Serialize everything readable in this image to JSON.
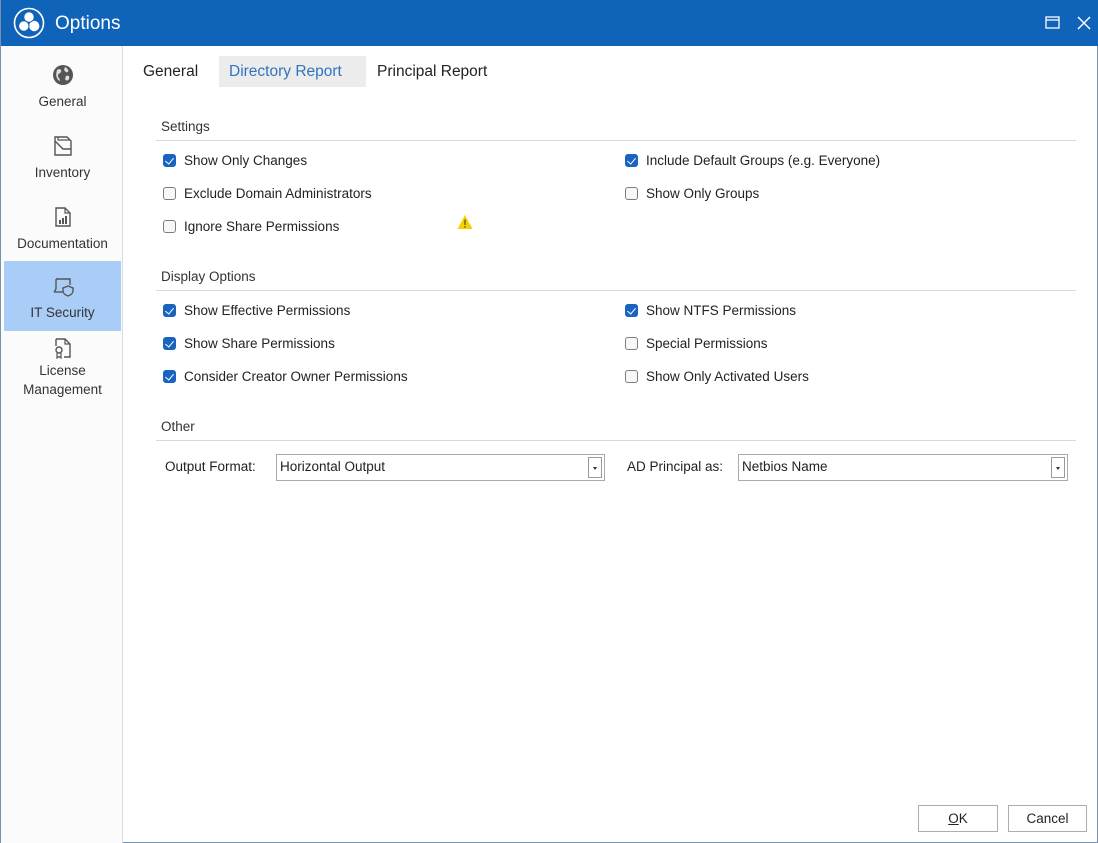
{
  "window": {
    "title": "Options",
    "app_icon": "hexagon-cluster-logo-icon",
    "controls": [
      {
        "name": "maximize",
        "icon": "maximize-icon"
      },
      {
        "name": "close",
        "icon": "close-icon"
      }
    ]
  },
  "sidebar": {
    "items": [
      {
        "label": "General",
        "icon": "globe-icon",
        "active": false
      },
      {
        "label": "Inventory",
        "icon": "folder-stack-icon",
        "active": false
      },
      {
        "label": "Documentation",
        "icon": "report-chart-icon",
        "active": false
      },
      {
        "label": "IT Security",
        "icon": "laptop-shield-icon",
        "active": true
      },
      {
        "label_line1": "License",
        "label_line2": "Management",
        "icon": "certificate-icon",
        "active": false
      }
    ]
  },
  "tabs": [
    {
      "label": "General",
      "active": false
    },
    {
      "label": "Directory Report",
      "active": true
    },
    {
      "label": "Principal Report",
      "active": false
    }
  ],
  "sections": {
    "settings": {
      "title": "Settings",
      "left": [
        {
          "label": "Show Only Changes",
          "checked": true
        },
        {
          "label": "Exclude Domain Administrators",
          "checked": false
        },
        {
          "label": "Ignore Share Permissions",
          "checked": false,
          "icon": "warning-icon"
        }
      ],
      "right": [
        {
          "label": "Include Default Groups (e.g. Everyone)",
          "checked": true
        },
        {
          "label": "Show Only Groups",
          "checked": false
        }
      ]
    },
    "display": {
      "title": "Display Options",
      "left": [
        {
          "label": "Show Effective Permissions",
          "checked": true
        },
        {
          "label": "Show Share Permissions",
          "checked": true
        },
        {
          "label": "Consider Creator Owner Permissions",
          "checked": true
        }
      ],
      "right": [
        {
          "label": "Show NTFS Permissions",
          "checked": true
        },
        {
          "label": "Special Permissions",
          "checked": false
        },
        {
          "label": "Show Only Activated Users",
          "checked": false
        }
      ]
    },
    "other": {
      "title": "Other",
      "output_format": {
        "label": "Output Format:",
        "value": "Horizontal Output"
      },
      "ad_principal": {
        "label": "AD Principal as:",
        "value": "Netbios Name"
      }
    }
  },
  "buttons": {
    "ok": {
      "mnemonic": "O",
      "rest": "K"
    },
    "cancel": "Cancel"
  },
  "colors": {
    "titlebar": "#0f63b9",
    "active_sidebar": "#a9cdf7",
    "active_tab_text": "#2f74c0",
    "checkbox_checked": "#1a64c0",
    "warning": "#f5d100"
  }
}
